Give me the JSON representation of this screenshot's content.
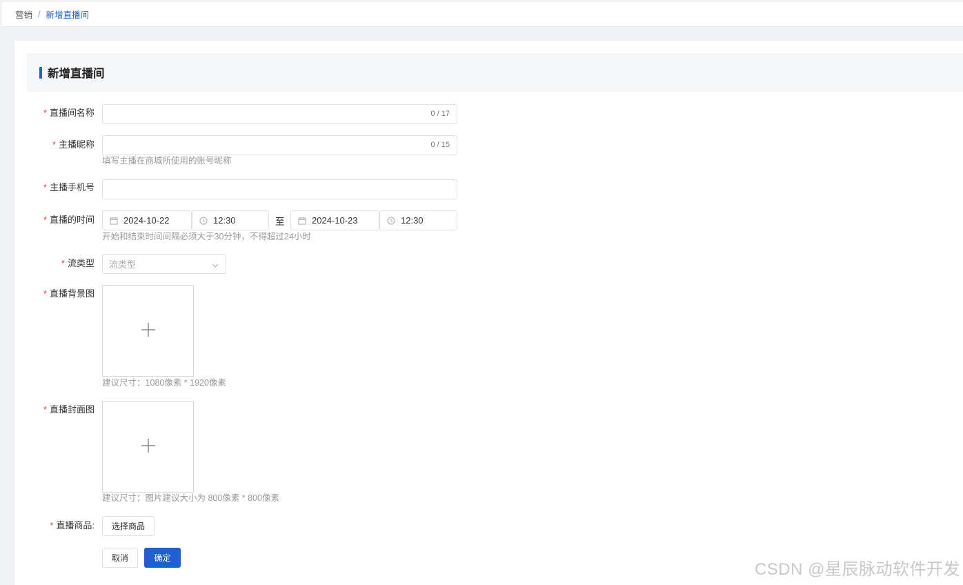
{
  "breadcrumb": {
    "parent": "营销",
    "separator": "/",
    "current": "新增直播间"
  },
  "section": {
    "title": "新增直播间"
  },
  "form": {
    "room_name": {
      "label": "直播间名称",
      "value": "",
      "counter": "0 / 17"
    },
    "anchor_nickname": {
      "label": "主播昵称",
      "value": "",
      "counter": "0 / 15",
      "hint": "填写主播在商城所使用的账号昵称"
    },
    "anchor_phone": {
      "label": "主播手机号",
      "value": ""
    },
    "live_time": {
      "label": "直播的时间",
      "start_date": "2024-10-22",
      "start_time": "12:30",
      "range_separator": "至",
      "end_date": "2024-10-23",
      "end_time": "12:30",
      "hint": "开始和结束时间间隔必须大于30分钟，不得超过24小时"
    },
    "stream_type": {
      "label": "流类型",
      "placeholder": "流类型"
    },
    "background_image": {
      "label": "直播背景图",
      "hint": "建议尺寸：1080像素 * 1920像素"
    },
    "cover_image": {
      "label": "直播封面图",
      "hint": "建议尺寸：图片建议大小为 800像素 * 800像素"
    },
    "products": {
      "label": "直播商品:",
      "button": "选择商品"
    },
    "required_mark": "*"
  },
  "actions": {
    "cancel": "取消",
    "confirm": "确定"
  },
  "watermark": "CSDN @星辰脉动软件开发",
  "colors": {
    "primary": "#1f5fce",
    "required": "#e0453a",
    "hint": "#9a9a9a"
  }
}
